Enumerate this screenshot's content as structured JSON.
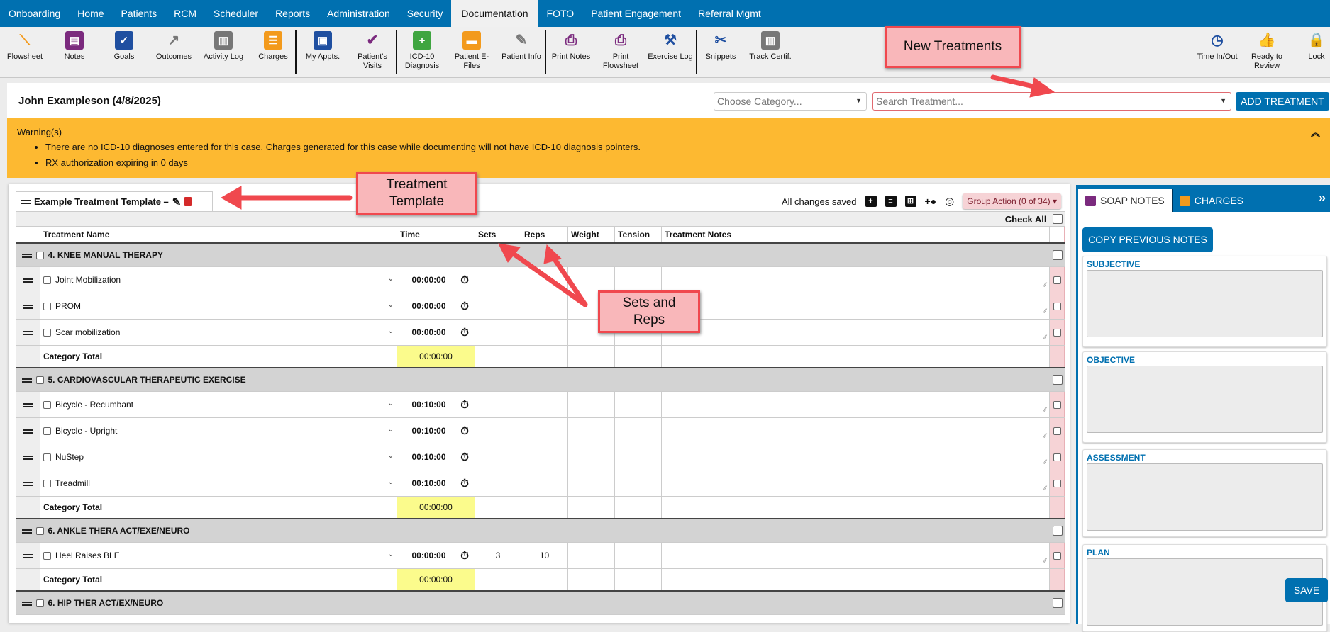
{
  "nav": [
    "Onboarding",
    "Home",
    "Patients",
    "RCM",
    "Scheduler",
    "Reports",
    "Administration",
    "Security",
    "Documentation",
    "FOTO",
    "Patient Engagement",
    "Referral Mgmt"
  ],
  "nav_active": "Documentation",
  "toolbar": [
    {
      "label": "Flowsheet",
      "icon": "flowsheet-icon",
      "color": "#f39a1c"
    },
    {
      "label": "Notes",
      "icon": "notes-icon",
      "color": "#7b2a7e"
    },
    {
      "label": "Goals",
      "icon": "goals-clipboard-icon",
      "color": "#1f4fa0"
    },
    {
      "label": "Outcomes",
      "icon": "outcomes-trend-icon",
      "color": "#777777"
    },
    {
      "label": "Activity Log",
      "icon": "activity-log-icon",
      "color": "#777777"
    },
    {
      "label": "Charges",
      "icon": "charges-icon",
      "color": "#f39a1c"
    },
    {
      "label": "My Appts.",
      "icon": "appointments-icon",
      "color": "#1f4fa0"
    },
    {
      "label": "Patient's Visits",
      "icon": "patient-visits-icon",
      "color": "#7b2a7e"
    },
    {
      "label": "ICD-10 Diagnosis",
      "icon": "icd10-medkit-icon",
      "color": "#3fa540"
    },
    {
      "label": "Patient E-Files",
      "icon": "folder-icon",
      "color": "#f39a1c"
    },
    {
      "label": "Patient Info",
      "icon": "patient-info-icon",
      "color": "#777777"
    },
    {
      "label": "Print Notes",
      "icon": "print-notes-icon",
      "color": "#7b2a7e"
    },
    {
      "label": "Print Flowsheet",
      "icon": "print-flowsheet-icon",
      "color": "#7b2a7e"
    },
    {
      "label": "Exercise Log",
      "icon": "exercise-log-icon",
      "color": "#1f4fa0"
    },
    {
      "label": "Snippets",
      "icon": "scissors-icon",
      "color": "#1f4fa0"
    },
    {
      "label": "Track Certif.",
      "icon": "track-certif-icon",
      "color": "#777777"
    },
    {
      "label": "Time In/Out",
      "icon": "clock-icon",
      "color": "#1f4fa0"
    },
    {
      "label": "Ready to Review",
      "icon": "thumbs-up-icon",
      "color": "#777777"
    },
    {
      "label": "Lock",
      "icon": "lock-icon",
      "color": "#c8202a"
    }
  ],
  "header": {
    "patient": "John Exampleson (4/8/2025)",
    "category_placeholder": "Choose Category...",
    "treatment_placeholder": "Search Treatment...",
    "add_button": "ADD TREATMENT"
  },
  "warning": {
    "title": "Warning(s)",
    "items": [
      "There are no ICD-10 diagnoses entered for this case. Charges generated for this case while documenting will not have ICD-10 diagnosis pointers.",
      "RX authorization expiring in 0 days"
    ]
  },
  "template": {
    "name": "Example Treatment Template –",
    "status": "All changes saved",
    "group_action": "Group Action (0 of 34)",
    "check_all": "Check All"
  },
  "columns": [
    "Treatment Name",
    "Time",
    "Sets",
    "Reps",
    "Weight",
    "Tension",
    "Treatment Notes"
  ],
  "total_label": "Category Total",
  "categories": [
    {
      "name": "4. KNEE MANUAL THERAPY",
      "total": "00:00:00",
      "items": [
        {
          "name": "Joint Mobilization",
          "time": "00:00:00",
          "sets": "",
          "reps": ""
        },
        {
          "name": "PROM",
          "time": "00:00:00",
          "sets": "",
          "reps": ""
        },
        {
          "name": "Scar mobilization",
          "time": "00:00:00",
          "sets": "",
          "reps": ""
        }
      ]
    },
    {
      "name": "5. CARDIOVASCULAR THERAPEUTIC EXERCISE",
      "total": "00:00:00",
      "items": [
        {
          "name": "Bicycle - Recumbant",
          "time": "00:10:00",
          "sets": "",
          "reps": ""
        },
        {
          "name": "Bicycle - Upright",
          "time": "00:10:00",
          "sets": "",
          "reps": ""
        },
        {
          "name": "NuStep",
          "time": "00:10:00",
          "sets": "",
          "reps": ""
        },
        {
          "name": "Treadmill",
          "time": "00:10:00",
          "sets": "",
          "reps": ""
        }
      ]
    },
    {
      "name": "6. ANKLE THERA ACT/EXE/NEURO",
      "total": "00:00:00",
      "items": [
        {
          "name": "Heel Raises BLE",
          "time": "00:00:00",
          "sets": "3",
          "reps": "10"
        }
      ]
    },
    {
      "name": "6. HIP THER ACT/EX/NEURO",
      "total": null,
      "items": []
    }
  ],
  "right_panel": {
    "tabs": [
      "SOAP NOTES",
      "CHARGES"
    ],
    "copy_button": "COPY PREVIOUS NOTES",
    "sections": [
      "SUBJECTIVE",
      "OBJECTIVE",
      "ASSESSMENT",
      "PLAN"
    ],
    "save": "SAVE"
  },
  "callouts": {
    "new_treatments": "New Treatments",
    "treatment_template": "Treatment Template",
    "sets_reps": "Sets and Reps"
  }
}
